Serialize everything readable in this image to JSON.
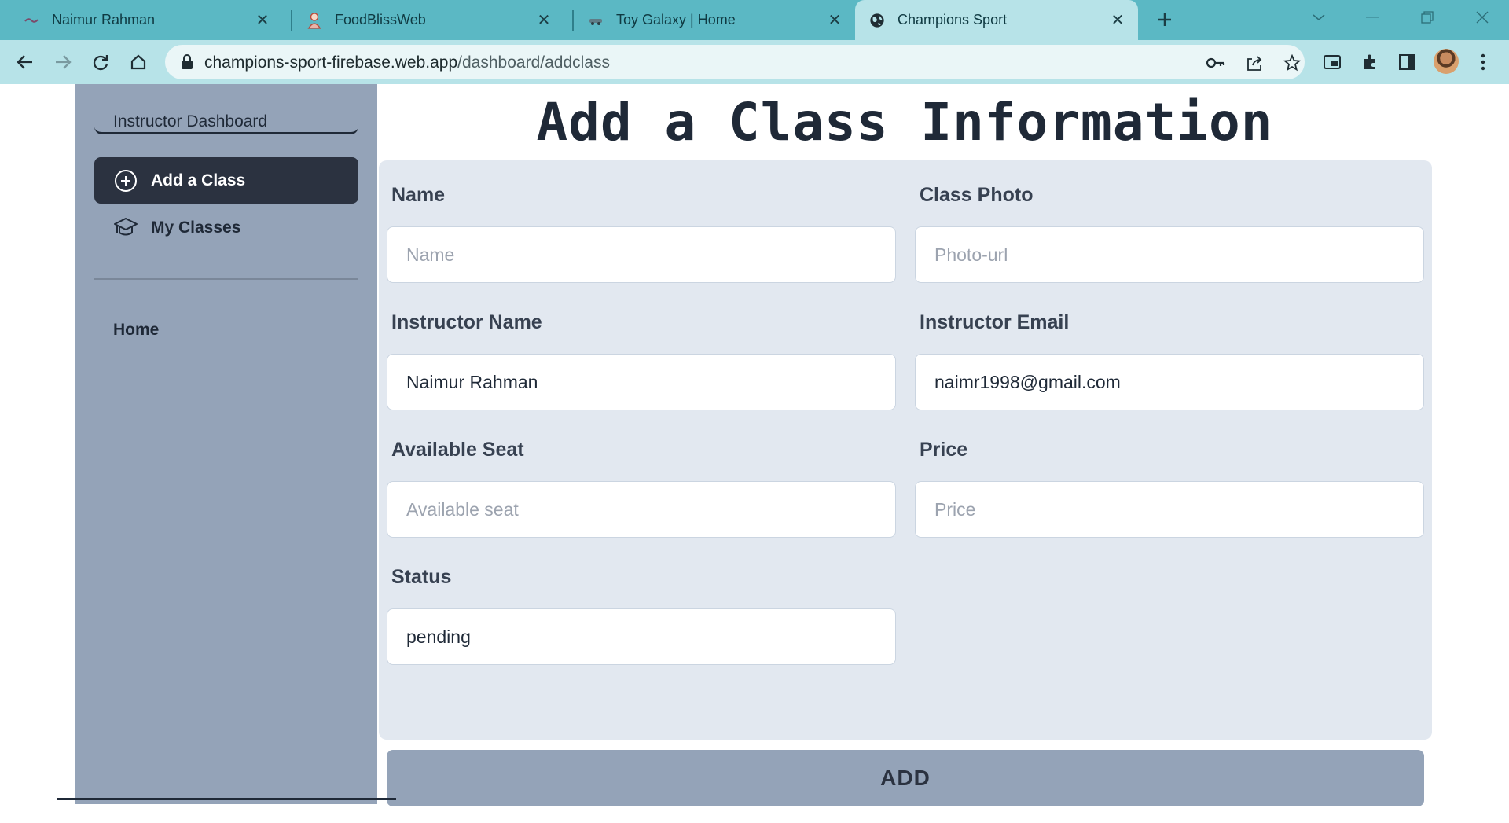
{
  "browser": {
    "tabs": [
      {
        "title": "Naimur Rahman",
        "icon": "site-favicon",
        "active": false
      },
      {
        "title": "FoodBlissWeb",
        "icon": "chef-favicon",
        "active": false
      },
      {
        "title": "Toy Galaxy | Home",
        "icon": "car-favicon",
        "active": false
      },
      {
        "title": "Champions Sport",
        "icon": "globe-icon",
        "active": true
      }
    ],
    "url_host": "champions-sport-firebase.web.app",
    "url_path": "/dashboard/addclass"
  },
  "sidebar": {
    "title": "Instructor Dashboard",
    "items": [
      {
        "label": "Add a Class",
        "icon": "plus-circle-icon",
        "active": true
      },
      {
        "label": "My Classes",
        "icon": "graduation-cap-icon",
        "active": false
      }
    ],
    "home_label": "Home"
  },
  "main": {
    "title": "Add a Class Information",
    "fields": {
      "name": {
        "label": "Name",
        "placeholder": "Name",
        "value": ""
      },
      "photo": {
        "label": "Class Photo",
        "placeholder": "Photo-url",
        "value": ""
      },
      "instructor_name": {
        "label": "Instructor Name",
        "placeholder": "",
        "value": "Naimur Rahman"
      },
      "instructor_email": {
        "label": "Instructor Email",
        "placeholder": "",
        "value": "naimr1998@gmail.com"
      },
      "seats": {
        "label": "Available Seat",
        "placeholder": "Available seat",
        "value": ""
      },
      "price": {
        "label": "Price",
        "placeholder": "Price",
        "value": ""
      },
      "status": {
        "label": "Status",
        "placeholder": "",
        "value": "pending"
      }
    },
    "submit_label": "ADD"
  },
  "colors": {
    "tabstrip": "#5bb8c4",
    "toolbar": "#b7e3e8",
    "sidebar": "#94a3b8",
    "active_item": "#2b3240",
    "form_bg": "#e2e8f0",
    "button": "#94a3b8"
  }
}
